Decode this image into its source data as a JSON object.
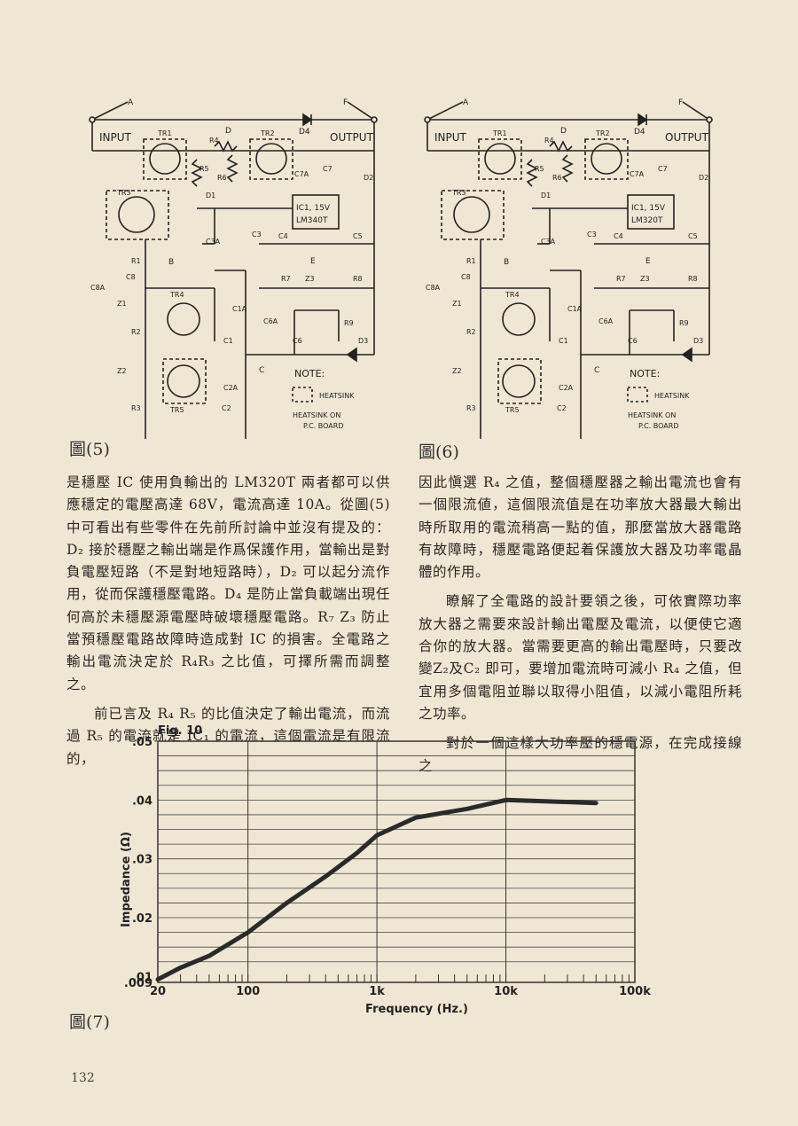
{
  "schematic_labels": {
    "input": "INPUT",
    "output": "OUTPUT",
    "point_a": "A",
    "point_b": "B",
    "point_c": "C",
    "point_d": "D",
    "point_e": "E",
    "point_f": "F",
    "tr1": "TR1",
    "tr2": "TR2",
    "tr3": "TR3",
    "tr4": "TR4",
    "tr5": "TR5",
    "r1": "R1",
    "r2": "R2",
    "r3": "R3",
    "r4": "R4",
    "r5": "R5",
    "r6": "R6",
    "r7": "R7",
    "r8": "R8",
    "r9": "R9",
    "d1": "D1",
    "d2": "D2",
    "d3": "D3",
    "d4": "D4",
    "z1": "Z1",
    "z2": "Z2",
    "z3": "Z3",
    "c1": "C1",
    "c1a": "C1A",
    "c2": "C2",
    "c2a": "C2A",
    "c3": "C3",
    "c3a": "C3A",
    "c4": "C4",
    "c5": "C5",
    "c6": "C6",
    "c6a": "C6A",
    "c7": "C7",
    "c7a": "C7A",
    "c8": "C8",
    "c8a": "C8A",
    "ic_left_1": "IC1, 15V",
    "ic_left_2": "LM340T",
    "ic_right_1": "IC1, 15V",
    "ic_right_2": "LM320T",
    "note": "NOTE:",
    "heatsink": "HEATSINK",
    "heatsink_pcb_1": "HEATSINK ON",
    "heatsink_pcb_2": "P.C. BOARD"
  },
  "figure5_caption": "圖(5)",
  "figure6_caption": "圖(6)",
  "figure7_caption": "圖(7)",
  "left_column": {
    "p1": "是穩壓 IC 使用負輸出的 LM320T 兩者都可以供應穩定的電壓高達 68V，電流高達 10A。從圖(5)中可看出有些零件在先前所討論中並沒有提及的：D₂ 接於穩壓之輸出端是作爲保護作用，當輸出是對負電壓短路（不是對地短路時），D₂ 可以起分流作用，從而保護穩壓電路。D₄ 是防止當負載端出現任何高於未穩壓源電壓時破壞穩壓電路。R₇ Z₃ 防止當預穩壓電路故障時造成對 IC 的損害。全電路之輸出電流決定於 R₄R₃ 之比值，可擇所需而調整之。",
    "p2": "前已言及 R₄ R₅ 的比值決定了輸出電流，而流過 R₅ 的電流就是 IC₁ 的電流，這個電流是有限流的，"
  },
  "right_column": {
    "p1": "因此愼選 R₄ 之值，整個穩壓器之輸出電流也會有一個限流値，這個限流值是在功率放大器最大輸出時所取用的電流稍高一點的值，那麼當放大器電路有故障時，穩壓電路便起着保護放大器及功率電晶體的作用。",
    "p2": "瞭解了全電路的設計要領之後，可依實際功率放大器之需要來設計輸出電壓及電流，以便使它適合你的放大器。當需要更高的輸出電壓時，只要改變Z₂及C₂ 即可，要增加電流時可減小 R₄ 之值，但宜用多個電阻並聯以取得小阻值，以減小電阻所耗之功率。",
    "p3": "對於一個這樣大功率壓的穩電源，在完成接線之"
  },
  "page_number": "132",
  "chart_data": {
    "type": "line",
    "title": "Fig. 10",
    "xlabel": "Frequency (Hz.)",
    "ylabel": "Impedance (Ω)",
    "x_scale": "log",
    "xlim": [
      20,
      100000
    ],
    "ylim": [
      0.009,
      0.05
    ],
    "x_ticks": [
      "20",
      "100",
      "1k",
      "10k",
      "100k"
    ],
    "x_tick_values": [
      20,
      100,
      1000,
      10000,
      100000
    ],
    "y_ticks": [
      ".009",
      ".01",
      ".02",
      ".03",
      ".04",
      ".05"
    ],
    "y_tick_values": [
      0.009,
      0.01,
      0.02,
      0.03,
      0.04,
      0.05
    ],
    "grid": true,
    "series": [
      {
        "x": [
          20,
          30,
          50,
          100,
          200,
          400,
          700,
          1000,
          2000,
          5000,
          10000,
          20000,
          50000
        ],
        "y": [
          0.0095,
          0.0115,
          0.0135,
          0.0175,
          0.0225,
          0.027,
          0.031,
          0.034,
          0.037,
          0.0385,
          0.04,
          0.0398,
          0.0395
        ]
      }
    ]
  }
}
